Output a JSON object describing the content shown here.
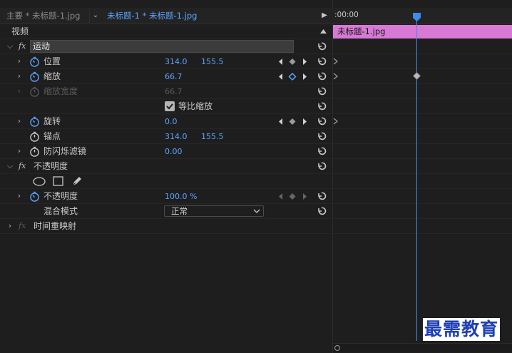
{
  "tabs": {
    "source": "主要 * 未标题-1.jpg",
    "sequence": "未标题-1 * 未标题-1.jpg"
  },
  "section_label": "视频",
  "motion": {
    "title": "运动",
    "position": {
      "label": "位置",
      "x": "314.0",
      "y": "155.5"
    },
    "scale": {
      "label": "缩放",
      "value": "66.7"
    },
    "scale_width": {
      "label": "缩放宽度",
      "value": "66.7"
    },
    "uniform_scale": {
      "label": "等比缩放",
      "checked": true
    },
    "rotation": {
      "label": "旋转",
      "value": "0.0"
    },
    "anchor": {
      "label": "锚点",
      "x": "314.0",
      "y": "155.5"
    },
    "anti_flicker": {
      "label": "防闪烁滤镜",
      "value": "0.00"
    }
  },
  "opacity": {
    "title": "不透明度",
    "opacity": {
      "label": "不透明度",
      "value": "100.0 %"
    },
    "blend": {
      "label": "混合模式",
      "value": "正常"
    }
  },
  "time_remap": {
    "title": "时间重映射"
  },
  "timeline": {
    "time": ":00:00",
    "clip": "未标题-1.jpg"
  },
  "colors": {
    "accent": "#5aa3ff",
    "clip": "#d879d6",
    "playhead": "#3f8ce8"
  },
  "watermark": "最需教育"
}
